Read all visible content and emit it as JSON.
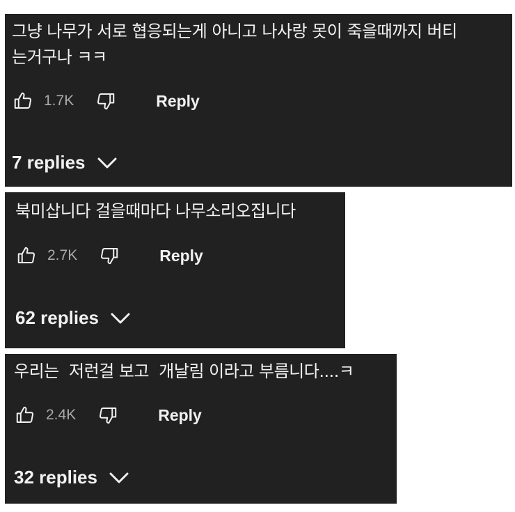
{
  "colors": {
    "card_background": "#212121",
    "page_background": "#ffffff",
    "text_primary": "#f1f1f1",
    "text_secondary": "#aaaaaa"
  },
  "comments": [
    {
      "text": "그냥 나무가 서로 협응되는게 아니고 나사랑 못이 죽을때까지 버티\n는거구나 ㅋㅋ",
      "likes": "1.7K",
      "reply_label": "Reply",
      "replies_label": "7 replies",
      "icons": [
        "thumb-up-icon",
        "thumb-down-icon",
        "chevron-down-icon"
      ]
    },
    {
      "text": "북미삽니다 걸을때마다 나무소리오집니다",
      "likes": "2.7K",
      "reply_label": "Reply",
      "replies_label": "62 replies",
      "icons": [
        "thumb-up-icon",
        "thumb-down-icon",
        "chevron-down-icon"
      ]
    },
    {
      "text": "우리는  저런걸 보고  개날림 이라고 부름니다....ㅋ",
      "likes": "2.4K",
      "reply_label": "Reply",
      "replies_label": "32 replies",
      "icons": [
        "thumb-up-icon",
        "thumb-down-icon",
        "chevron-down-icon"
      ]
    }
  ]
}
